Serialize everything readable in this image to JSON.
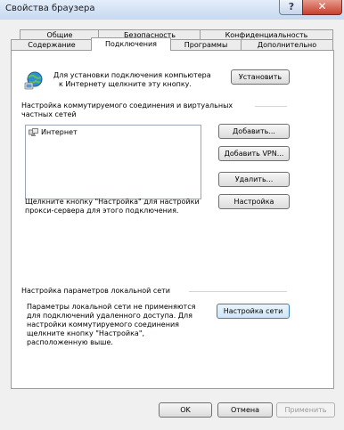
{
  "window": {
    "title": "Свойства браузера",
    "help": "?",
    "close": "✕"
  },
  "tabs_row1": [
    "Общие",
    "Безопасность",
    "Конфиденциальность"
  ],
  "tabs_row2": [
    "Содержание",
    "Подключения",
    "Программы",
    "Дополнительно"
  ],
  "active_tab": "Подключения",
  "setup": {
    "text_line1": "Для установки подключения компьютера",
    "text_line2": "к Интернету щелкните эту кнопку.",
    "button": "Установить"
  },
  "dialup": {
    "heading_line1": "Настройка коммутируемого соединения и виртуальных",
    "heading_line2": "частных сетей",
    "connections": [
      {
        "name": "Интернет",
        "icon": "network-connection-icon"
      }
    ],
    "add_button": "Добавить...",
    "add_vpn_button": "Добавить VPN...",
    "remove_button": "Удалить...",
    "proxy_text_line1": "Щелкните кнопку \"Настройка\" для настройки",
    "proxy_text_line2": "прокси-сервера для этого подключения.",
    "settings_button": "Настройка"
  },
  "lan": {
    "heading": "Настройка параметров локальной сети",
    "text_lines": [
      "Параметры локальной сети не применяются",
      "для подключений удаленного доступа. Для",
      "настройки коммутируемого соединения",
      "щелкните кнопку \"Настройка\",",
      "расположенную выше."
    ],
    "button": "Настройка сети"
  },
  "footer": {
    "ok": "OK",
    "cancel": "Отмена",
    "apply": "Применить"
  }
}
